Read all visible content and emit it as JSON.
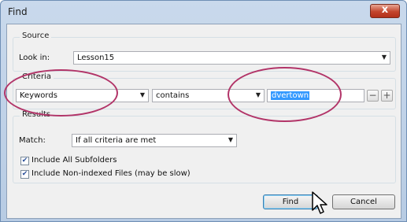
{
  "window": {
    "title": "Find",
    "close_glyph": "x"
  },
  "source": {
    "group_label": "Source",
    "look_in_label": "Look in:",
    "look_in_value": "Lesson15"
  },
  "criteria": {
    "group_label": "Criteria",
    "field_value": "Keywords",
    "operator_value": "contains",
    "search_text": "dvertown",
    "remove_glyph": "−",
    "add_glyph": "+"
  },
  "results": {
    "group_label": "Results",
    "match_label": "Match:",
    "match_value": "If all criteria are met",
    "include_subfolders_label": "Include All Subfolders",
    "include_subfolders_checked": true,
    "include_nonindexed_label": "Include Non-indexed Files (may be slow)",
    "include_nonindexed_checked": true
  },
  "buttons": {
    "find": "Find",
    "cancel": "Cancel"
  },
  "icons": {
    "close": "close-icon",
    "dropdown": "chevron-down-icon",
    "checkbox": "checkmark-icon",
    "cursor": "mouse-pointer-icon"
  },
  "colors": {
    "annotation": "#b23468",
    "selection": "#3399ff",
    "title_bar": "#c9d9ec"
  }
}
